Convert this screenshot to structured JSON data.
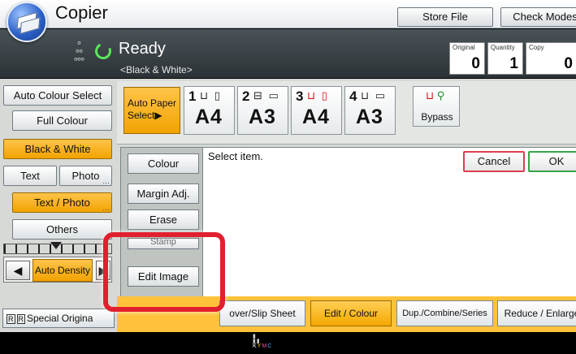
{
  "title_bar": {
    "app_title": "Copier",
    "store_file": "Store File",
    "check_modes": "Check Modes"
  },
  "status": {
    "ready": "Ready",
    "mode_sub": "<Black & White>",
    "counters": [
      {
        "label": "Original",
        "value": "0"
      },
      {
        "label": "Quantity",
        "value": "1"
      },
      {
        "label": "Copy",
        "value": "0"
      }
    ]
  },
  "color_modes": {
    "auto_colour_select": "Auto Colour Select",
    "full_colour": "Full Colour",
    "black_white": "Black & White",
    "selected": "Black & White"
  },
  "original_type": {
    "text": "Text",
    "photo": "Photo",
    "text_photo": "Text / Photo",
    "others": "Others",
    "selected": "Text / Photo"
  },
  "density": {
    "label": "Auto Density",
    "left": "◀",
    "right": "▶"
  },
  "paper": {
    "auto_paper": "Auto Paper",
    "auto_paper_select": "Select▶",
    "trays": [
      {
        "num": "1",
        "icons": "⊔ ▯",
        "size": "A4"
      },
      {
        "num": "2",
        "icons": "⊟ ▭",
        "size": "A3"
      },
      {
        "num": "3",
        "icons": "⊔ ▯",
        "size": "A4",
        "alert": true
      },
      {
        "num": "4",
        "icons": "⊔ ▭",
        "size": "A3"
      }
    ],
    "bypass": "Bypass"
  },
  "sub_menu": {
    "colour": "Colour",
    "margin_adj": "Margin Adj.",
    "erase": "Erase",
    "stamp": "Stamp",
    "edit_image": "Edit Image"
  },
  "content": {
    "prompt": "Select item.",
    "cancel": "Cancel",
    "ok": "OK"
  },
  "tabs": {
    "special_original": "Special Origina",
    "cover_slip": "over/Slip Sheet",
    "edit_colour": "Edit / Colour",
    "dup_combine": "Dup./Combine/Series",
    "reduce_enlarge": "Reduce / Enlarge",
    "active": "Edit / Colour"
  },
  "colors": {
    "selected_orange": "#f2a300",
    "highlight_red": "#e0202e",
    "ready_green": "#5be65b",
    "status_bar": "#2b3236"
  }
}
